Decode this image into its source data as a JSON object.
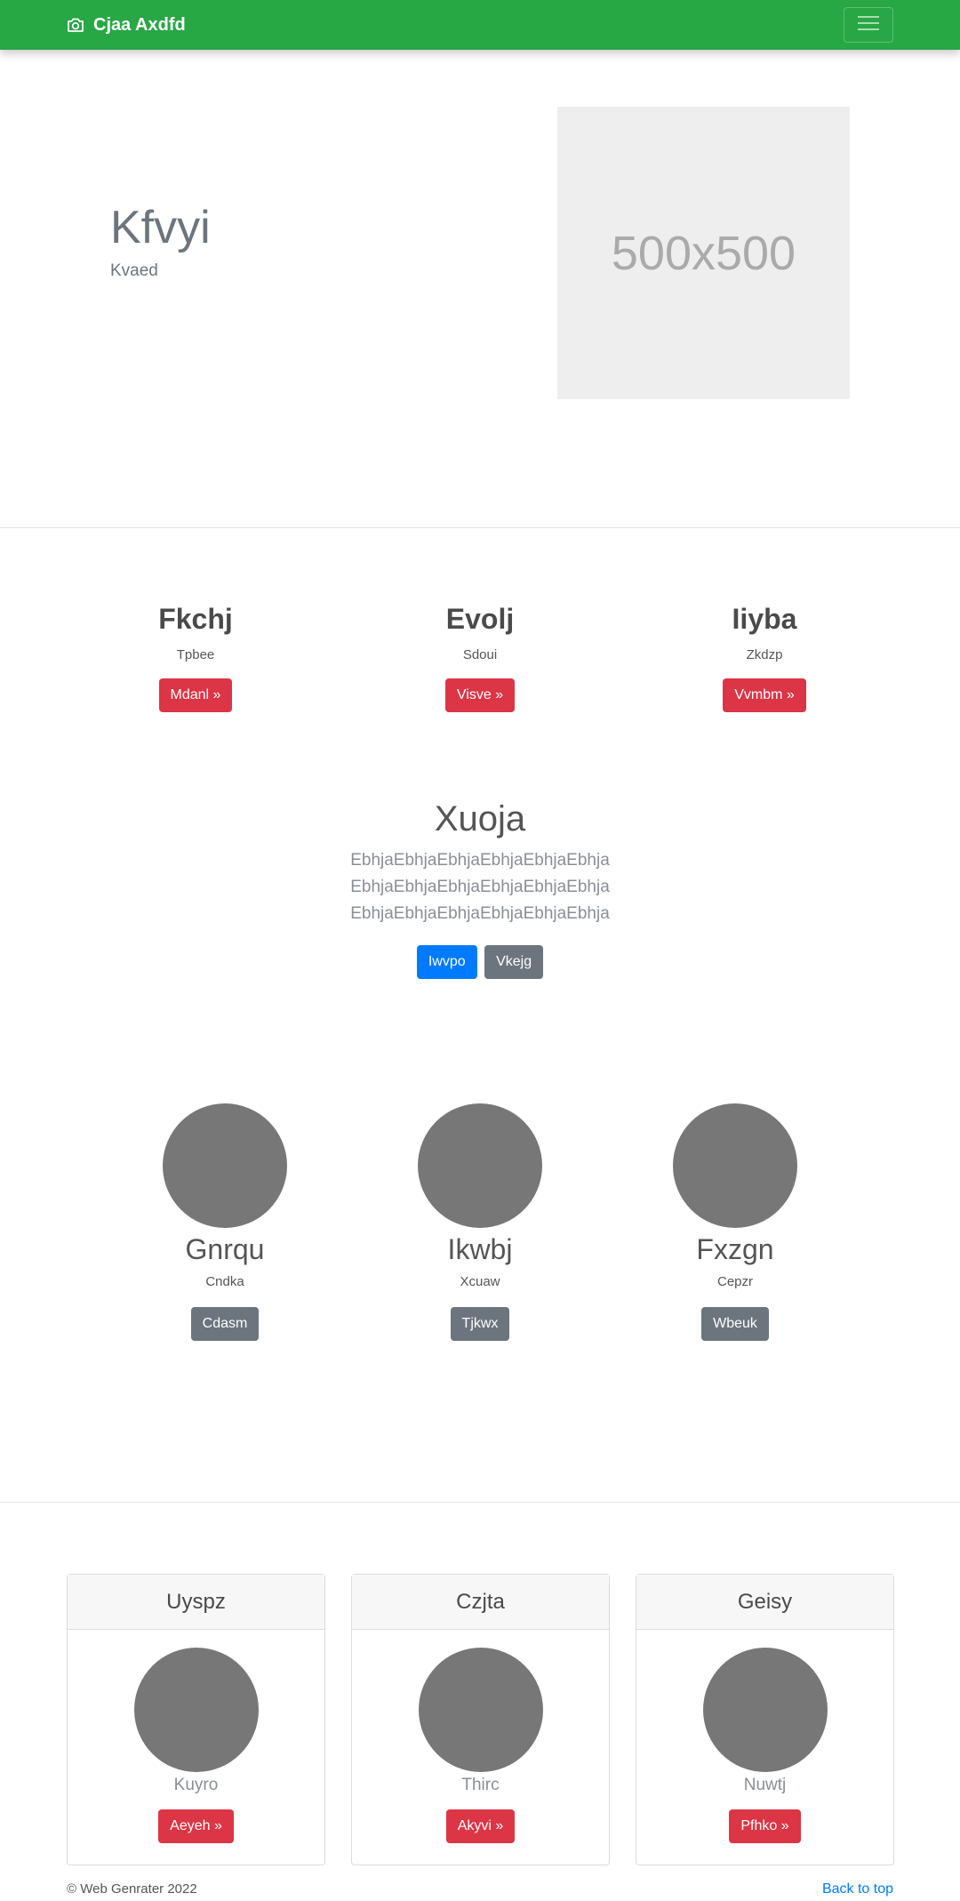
{
  "navbar": {
    "brand": "Cjaa Axdfd",
    "brand_icon": "camera-icon",
    "toggler_icon": "hamburger-menu-icon",
    "bg_color": "#28a745"
  },
  "hero": {
    "title": "Kfvyi",
    "subtitle": "Kvaed",
    "image_text": "500x500"
  },
  "features": [
    {
      "title": "Fkchj",
      "text": "Tpbee",
      "button": "Mdanl »"
    },
    {
      "title": "Evolj",
      "text": "Sdoui",
      "button": "Visve »"
    },
    {
      "title": "Iiyba",
      "text": "Zkdzp",
      "button": "Vvmbm »"
    }
  ],
  "center": {
    "title": "Xuoja",
    "lead": "EbhjaEbhjaEbhjaEbhjaEbhjaEbhja EbhjaEbhjaEbhjaEbhjaEbhjaEbhja EbhjaEbhjaEbhjaEbhjaEbhjaEbhja",
    "primary_button": "Iwvpo",
    "secondary_button": "Vkejg"
  },
  "circles": [
    {
      "title": "Gnrqu",
      "text": "Cndka",
      "button": "Cdasm"
    },
    {
      "title": "Ikwbj",
      "text": "Xcuaw",
      "button": "Tjkwx"
    },
    {
      "title": "Fxzgn",
      "text": "Cepzr",
      "button": "Wbeuk"
    }
  ],
  "cards": [
    {
      "header": "Uyspz",
      "name": "Kuyro",
      "button": "Aeyeh »"
    },
    {
      "header": "Czjta",
      "name": "Thirc",
      "button": "Akyvi »"
    },
    {
      "header": "Geisy",
      "name": "Nuwtj",
      "button": "Pfhko »"
    }
  ],
  "footer": {
    "copyright": "© Web Genrater 2022",
    "back_to_top": "Back to top"
  },
  "colors": {
    "danger": "#dc3545",
    "primary": "#007bff",
    "secondary": "#6c757d"
  }
}
